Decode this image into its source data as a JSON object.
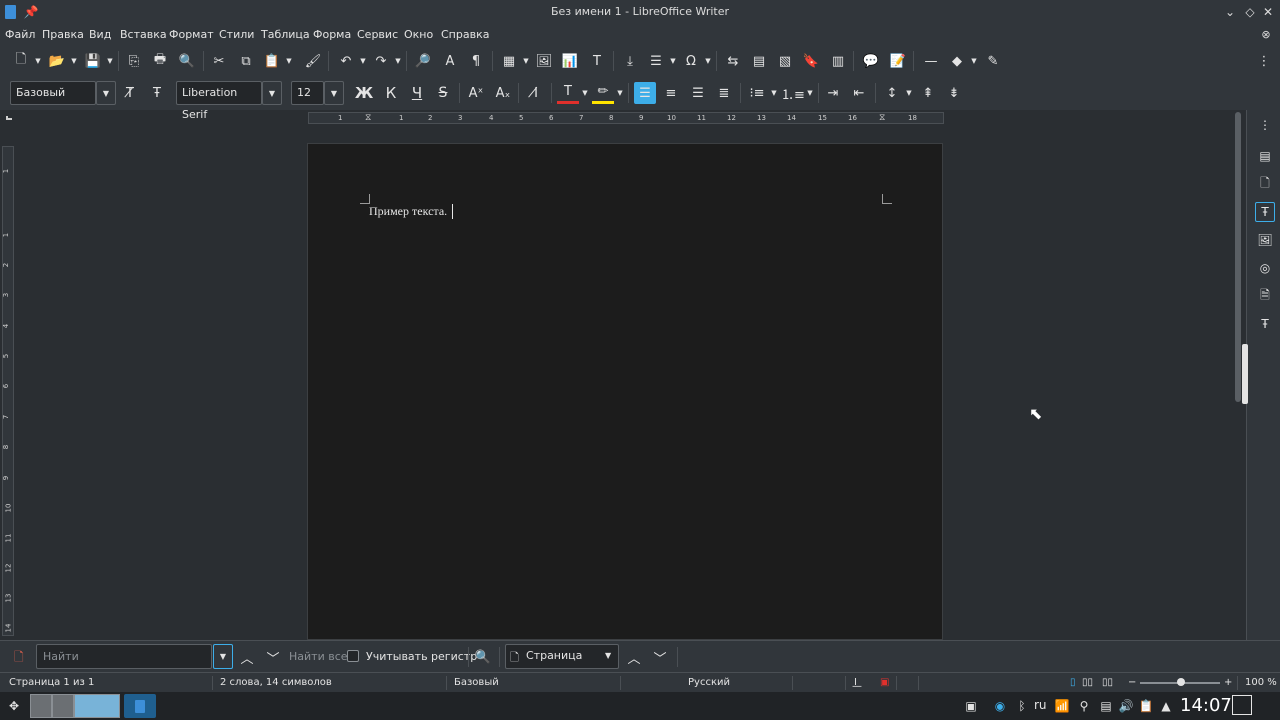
{
  "window": {
    "title": "Без имени 1 - LibreOffice Writer"
  },
  "menu": [
    "Файл",
    "Правка",
    "Вид",
    "Вставка",
    "Формат",
    "Стили",
    "Таблица",
    "Форма",
    "Сервис",
    "Окно",
    "Справка"
  ],
  "format_bar": {
    "paragraph_style": "Базовый",
    "font_name": "Liberation Serif",
    "font_size": "12",
    "bold_label": "Ж",
    "italic_label": "К",
    "underline_label": "Ч",
    "strike_label": "S"
  },
  "ruler": {
    "ticks": [
      "1",
      "1",
      "2",
      "3",
      "4",
      "5",
      "6",
      "7",
      "8",
      "9",
      "10",
      "11",
      "12",
      "13",
      "14",
      "15",
      "16",
      "18"
    ]
  },
  "vruler": {
    "ticks": [
      "1",
      "1",
      "2",
      "3",
      "4",
      "5",
      "6",
      "7",
      "8",
      "9",
      "10",
      "11",
      "12",
      "13",
      "14"
    ]
  },
  "document": {
    "text": "Пример текста."
  },
  "find_bar": {
    "placeholder": "Найти",
    "find_all_label": "Найти все",
    "match_case_label": "Учитывать регистр",
    "search_scope": "Страница"
  },
  "status": {
    "page": "Страница 1 из 1",
    "word_count": "2 слова, 14 символов",
    "style": "Базовый",
    "language": "Русский",
    "zoom": "100 %"
  },
  "taskbar": {
    "lang": "ru",
    "clock": "14:07"
  }
}
